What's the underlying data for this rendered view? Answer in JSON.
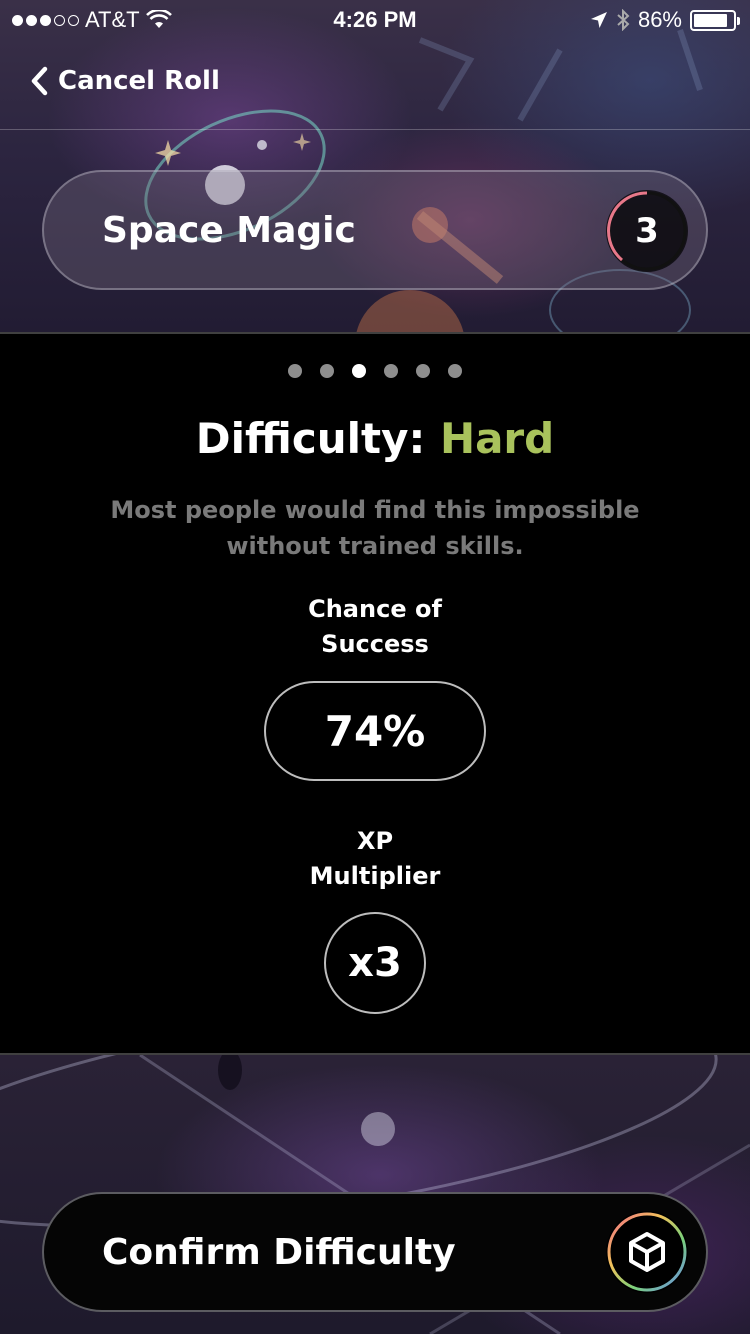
{
  "status_bar": {
    "carrier": "AT&T",
    "time": "4:26 PM",
    "battery": "86%",
    "battery_level": 0.86,
    "signal_bars_filled": 3,
    "signal_bars_total": 5
  },
  "nav": {
    "back_label": "Cancel Roll"
  },
  "skill": {
    "name": "Space Magic",
    "level": "3"
  },
  "pager": {
    "count": 6,
    "active_index": 2
  },
  "difficulty": {
    "prefix": "Difficulty:",
    "value": "Hard",
    "description": "Most people would find this impossible without trained skills."
  },
  "stats": {
    "chance_label_line1": "Chance of",
    "chance_label_line2": "Success",
    "chance_value": "74%",
    "xp_label_line1": "XP",
    "xp_label_line2": "Multiplier",
    "xp_value": "x3"
  },
  "confirm": {
    "label": "Confirm Difficulty",
    "icon": "cube-icon"
  },
  "colors": {
    "difficulty_accent": "#a9c25c",
    "panel_bg": "#000000",
    "muted_text": "#7a7a7a"
  }
}
